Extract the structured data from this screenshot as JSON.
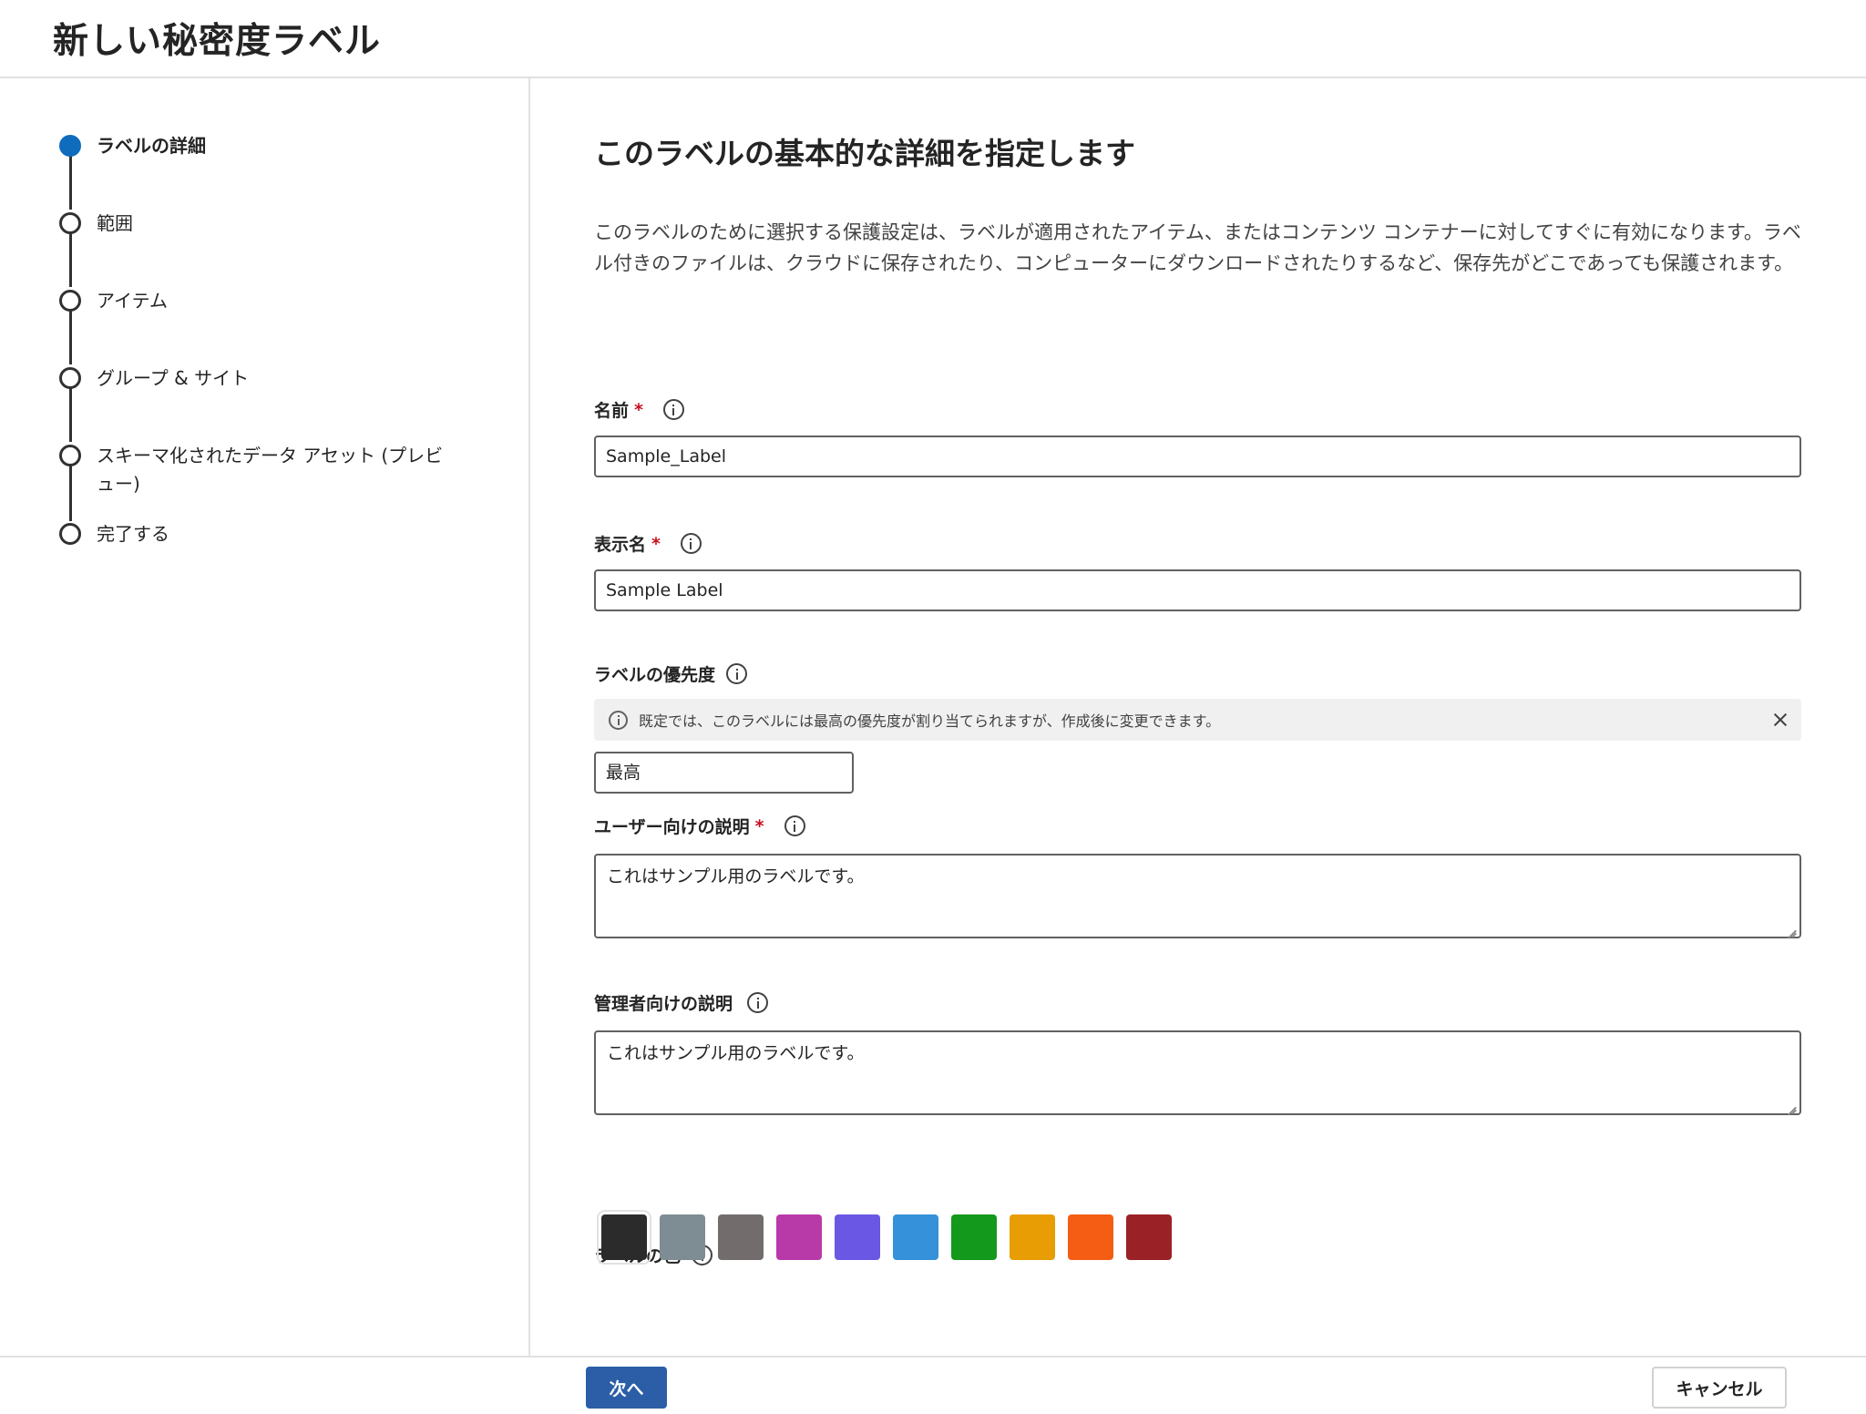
{
  "header": {
    "title": "新しい秘密度ラベル"
  },
  "steps": [
    {
      "label": "ラベルの詳細",
      "state": "current"
    },
    {
      "label": "範囲",
      "state": "pending"
    },
    {
      "label": "アイテム",
      "state": "pending"
    },
    {
      "label": "グループ & サイト",
      "state": "pending"
    },
    {
      "label": "スキーマ化されたデータ アセット (プレビュー)",
      "state": "pending"
    },
    {
      "label": "完了する",
      "state": "pending"
    }
  ],
  "main": {
    "title": "このラベルの基本的な詳細を指定します",
    "intro": "このラベルのために選択する保護設定は、ラベルが適用されたアイテム、またはコンテンツ コンテナーに対してすぐに有効になります。ラベル付きのファイルは、クラウドに保存されたり、コンピューターにダウンロードされたりするなど、保存先がどこであっても保護されます。"
  },
  "fields": {
    "name": {
      "label": "名前",
      "required_mark": "*",
      "value": "Sample_Label"
    },
    "display_name": {
      "label": "表示名",
      "required_mark": "*",
      "value": "Sample Label"
    },
    "priority": {
      "label": "ラベルの優先度",
      "info_message": "既定では、このラベルには最高の優先度が割り当てられますが、作成後に変更できます。",
      "value": "最高"
    },
    "user_description": {
      "label": "ユーザー向けの説明",
      "required_mark": "*",
      "value": "これはサンプル用のラベルです。"
    },
    "admin_description": {
      "label": "管理者向けの説明",
      "value": "これはサンプル用のラベルです。"
    },
    "label_color": {
      "label": "ラベルの色",
      "selected": "#2b2b2b",
      "colors": [
        "#2b2b2b",
        "#7e8d93",
        "#726d6c",
        "#b83aa8",
        "#6a58e4",
        "#3491da",
        "#13991b",
        "#e79d03",
        "#f55d14",
        "#9a2126"
      ]
    }
  },
  "footer": {
    "next_label": "次へ",
    "cancel_label": "キャンセル"
  }
}
